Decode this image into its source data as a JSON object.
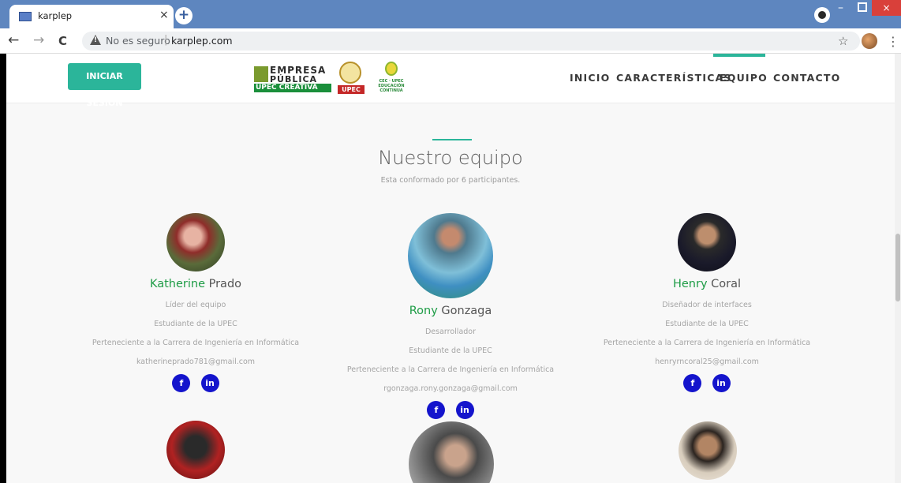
{
  "browser": {
    "tab_title": "karplep",
    "tab_close": "×",
    "new_tab": "+",
    "security_label": "No es seguro",
    "separator": "|",
    "url": "karplep.com",
    "icons": [
      "back-icon",
      "forward-icon",
      "reload-icon",
      "warning-icon",
      "star-icon",
      "profile-icon",
      "menu-icon"
    ],
    "back": "←",
    "forward": "→",
    "reload": "C",
    "star": "☆",
    "menu": "⋮",
    "minimize": "–",
    "close": "×"
  },
  "header": {
    "login_label": "INICIAR SESIÓN",
    "logos": {
      "empresa_top": "EMPRESA",
      "empresa_bottom": "PÚBLICA",
      "empresa_strip": "UPEC CREATIVA",
      "upec": "UPEC",
      "cec": "CEC · UPEC EDUCACIÓN CONTINUA"
    },
    "menu": [
      "INICIO",
      "CARACTERÍSTICAS",
      "EQUIPO",
      "CONTACTO"
    ],
    "active_menu": "EQUIPO",
    "accent_color": "#2bb59a"
  },
  "team": {
    "title": "Nuestro equipo",
    "subtitle": "Esta conformado por 6 participantes.",
    "members": [
      {
        "first": "Katherine",
        "last": "Prado",
        "role": "Líder del equipo",
        "study": "Estudiante de la UPEC",
        "career": "Perteneciente a la Carrera de Ingeniería en Informática",
        "email": "katherineprado781@gmail.com"
      },
      {
        "first": "Rony",
        "last": "Gonzaga",
        "role": "Desarrollador",
        "study": "Estudiante de la UPEC",
        "career": "Perteneciente a la Carrera de Ingeniería en Informática",
        "email": "rgonzaga.rony.gonzaga@gmail.com"
      },
      {
        "first": "Henry",
        "last": "Coral",
        "role": "Diseñador de interfaces",
        "study": "Estudiante de la UPEC",
        "career": "Perteneciente a la Carrera de Ingeniería en Informática",
        "email": "henryrncoral25@gmail.com"
      }
    ],
    "social": {
      "facebook": "f",
      "linkedin": "in"
    },
    "name_color": "#1e9c46",
    "social_color": "#1414cc"
  }
}
